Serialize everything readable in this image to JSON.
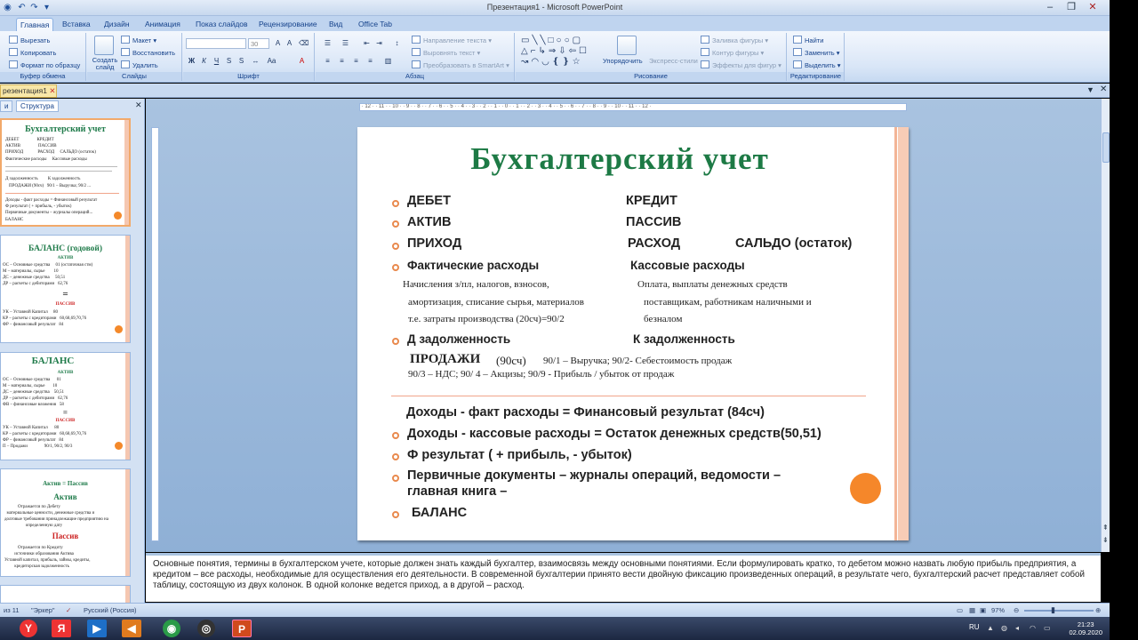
{
  "window": {
    "title": "Презентация1 - Microsoft PowerPoint"
  },
  "ribbon": {
    "tabs": [
      "Главная",
      "Вставка",
      "Дизайн",
      "Анимация",
      "Показ слайдов",
      "Рецензирование",
      "Вид",
      "Office Tab"
    ],
    "clipboard": {
      "cut": "Вырезать",
      "copy": "Копировать",
      "format_painter": "Формат по образцу",
      "paste": "Вставить",
      "label": "Буфер обмена"
    },
    "slides": {
      "new_slide": "Создать слайд",
      "layout": "Макет",
      "reset": "Восстановить",
      "delete": "Удалить",
      "label": "Слайды"
    },
    "font": {
      "size": "30",
      "label": "Шрифт"
    },
    "paragraph": {
      "text_direction": "Направление текста",
      "align_text": "Выровнять текст",
      "convert_smartart": "Преобразовать в SmartArt",
      "label": "Абзац"
    },
    "drawing": {
      "arrange": "Упорядочить",
      "quick_styles": "Экспресс-стили",
      "fill": "Заливка фигуры",
      "outline": "Контур фигуры",
      "effects": "Эффекты для фигур",
      "label": "Рисование"
    },
    "editing": {
      "find": "Найти",
      "replace": "Заменить",
      "select": "Выделить",
      "label": "Редактирование"
    }
  },
  "document_tab": "резентация1",
  "panel": {
    "tabs": [
      "и",
      "Структура"
    ]
  },
  "thumbnails": [
    {
      "title": "Бухгалтерский учет"
    },
    {
      "title": "БАЛАНС (годовой)",
      "sub": "АКТИВ",
      "sub2": "ПАССИВ"
    },
    {
      "title": "БАЛАНС",
      "sub": "АКТИВ",
      "sub2": "ПАССИВ"
    },
    {
      "title": "Актив = Пассив",
      "sub": "Актив",
      "sub2": "Пассив"
    }
  ],
  "slide": {
    "title": "Бухгалтерский учет",
    "debit": "ДЕБЕТ",
    "credit": "КРЕДИТ",
    "asset": "АКТИВ",
    "liability": "ПАССИВ",
    "income": "ПРИХОД",
    "expense": "РАСХОД",
    "balance_rest": "САЛЬДО (остаток)",
    "actual_costs": "Фактические расходы",
    "cash_costs": "Кассовые расходы",
    "actual_line1": "Начисления з/пл, налогов, взносов,",
    "actual_line2": "амортизация, списание сырья, материалов",
    "actual_line3": "т.е. затраты производства (20сч)=90/2",
    "cash_line1": "Оплата, выплаты денежных средств",
    "cash_line2": "поставщикам, работникам наличными и",
    "cash_line3": "безналом",
    "d_debt": "Д задолженность",
    "k_debt": "К задолженность",
    "sales_bold": "ПРОДАЖИ",
    "sales_acc": "(90сч)",
    "sales_line1": "90/1 – Выручка; 90/2- Себестоимость продаж",
    "sales_line2": "90/3 – НДС;  90/ 4 – Акцизы;  90/9 - Прибыль / убыток от продаж",
    "fin_result": "Доходы - факт расходы = Финансовый результат (84сч)",
    "cash_rest": "Доходы - кассовые расходы = Остаток денежных средств(50,51)",
    "f_result": "Ф результат ( + прибыль,    -  убыток)",
    "primary_docs1": "Первичные документы – журналы операций, ведомости –",
    "primary_docs2": "главная книга –",
    "balance": "БАЛАНС"
  },
  "notes": {
    "text": "Основные понятия, термины в бухгалтерском учете, которые должен знать каждый бухгалтер, взаимосвязь между основными понятиями. Если формулировать кратко, то дебетом можно назвать любую прибыль предприятия, а кредитом – все расходы, необходимые для осуществления его деятельности. В современной бухгалтерии принято вести двойную фиксацию произведенных операций, в результате чего, бухгалтерский расчет представляет собой таблицу, состоящую из двух колонок.  В одной колонке ведется приход, а в другой – расход."
  },
  "status": {
    "slide_count": "из 11",
    "theme": "\"Эркер\"",
    "language": "Русский (Россия)",
    "zoom": "97%"
  },
  "taskbar": {
    "lang": "RU",
    "time": "21:23",
    "date": "02.09.2020"
  }
}
